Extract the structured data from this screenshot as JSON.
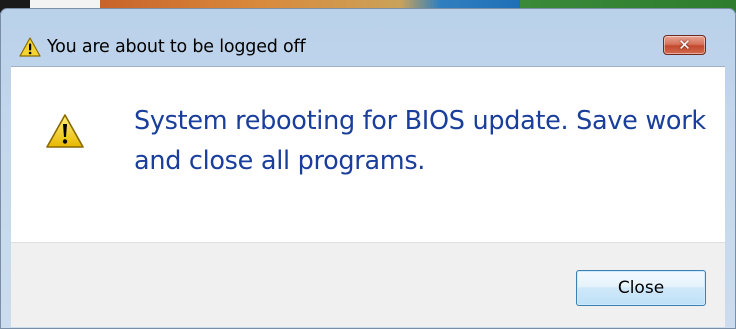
{
  "window": {
    "title": "You are about to be logged off",
    "title_icon": "warning-icon",
    "close_icon": "close-icon"
  },
  "message": {
    "icon": "warning-icon",
    "text": "System rebooting for BIOS update. Save work and close all programs."
  },
  "buttons": {
    "close_label": "Close"
  },
  "colors": {
    "message_text": "#1a3e9b",
    "warning_fill": "#f5d334",
    "close_button_red": "#c44a2e"
  }
}
